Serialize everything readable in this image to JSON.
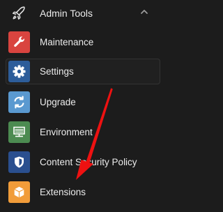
{
  "section": {
    "title": "Admin Tools",
    "icon": "rocket-icon",
    "expanded": true
  },
  "menu": {
    "items": [
      {
        "label": "Maintenance",
        "icon": "wrench-icon",
        "color": "#d9443f",
        "active": false
      },
      {
        "label": "Settings",
        "icon": "gear-icon",
        "color": "#2d5d9a",
        "active": true
      },
      {
        "label": "Upgrade",
        "icon": "refresh-icon",
        "color": "#5a99d0",
        "active": false
      },
      {
        "label": "Environment",
        "icon": "server-icon",
        "color": "#4c8b51",
        "active": false
      },
      {
        "label": "Content Security Policy",
        "icon": "shield-icon",
        "color": "#2a4f8f",
        "active": false
      },
      {
        "label": "Extensions",
        "icon": "box-icon",
        "color": "#f19c3a",
        "active": false
      }
    ]
  },
  "annotation": {
    "pointer": "red-arrow-icon",
    "color": "#ee1111"
  }
}
